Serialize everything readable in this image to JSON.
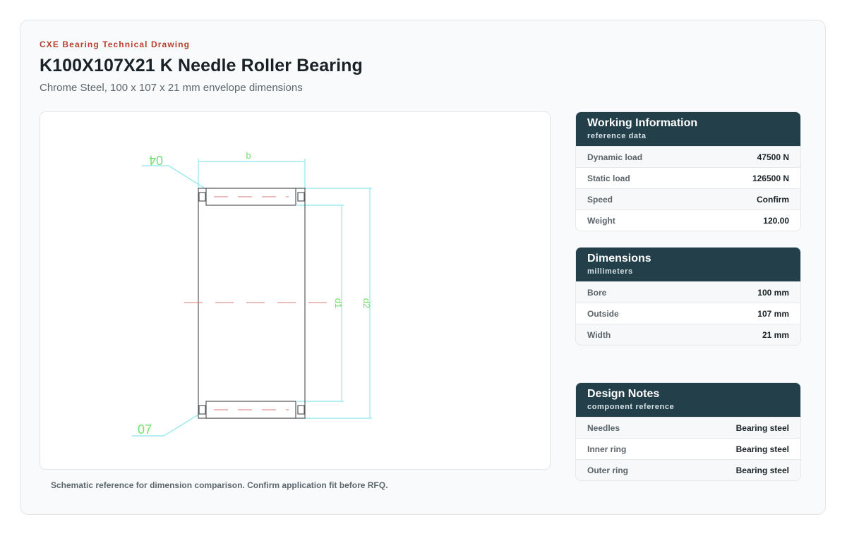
{
  "header": {
    "eyebrow": "CXE Bearing Technical Drawing",
    "title": "K100X107X21 K Needle Roller Bearing",
    "subtitle": "Chrome Steel, 100 x 107 x 21 mm envelope dimensions"
  },
  "drawing": {
    "labels": {
      "width": "b",
      "inner_dia": "d1",
      "outer_dia": "d2",
      "callout_top": "04",
      "callout_bottom": "07"
    },
    "colors": {
      "dimension_lines": "#8be8ee",
      "label_green": "#6ee26e",
      "outline": "#55585a",
      "centerline": "#d97a7a"
    }
  },
  "caption": "Schematic reference for dimension comparison. Confirm application fit before RFQ.",
  "panels": [
    {
      "title": "Working Information",
      "subtitle": "reference data",
      "rows": [
        {
          "label": "Dynamic load",
          "value": "47500 N"
        },
        {
          "label": "Static load",
          "value": "126500 N"
        },
        {
          "label": "Speed",
          "value": "Confirm"
        },
        {
          "label": "Weight",
          "value": "120.00"
        }
      ]
    },
    {
      "title": "Dimensions",
      "subtitle": "millimeters",
      "rows": [
        {
          "label": "Bore",
          "value": "100 mm"
        },
        {
          "label": "Outside",
          "value": "107 mm"
        },
        {
          "label": "Width",
          "value": "21 mm"
        }
      ]
    },
    {
      "title": "Design Notes",
      "subtitle": "component reference",
      "rows": [
        {
          "label": "Needles",
          "value": "Bearing steel"
        },
        {
          "label": "Inner ring",
          "value": "Bearing steel"
        },
        {
          "label": "Outer ring",
          "value": "Bearing steel"
        }
      ]
    }
  ],
  "theme": {
    "accent": "#b5402f",
    "panel_header": "#233f4a"
  }
}
